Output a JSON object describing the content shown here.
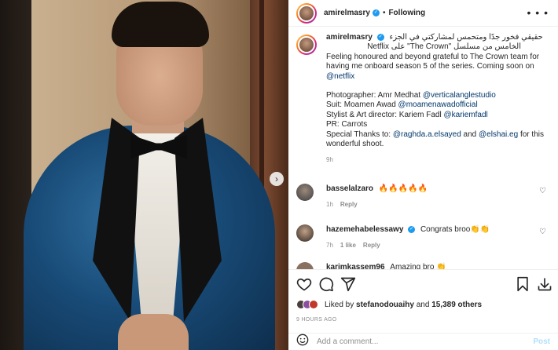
{
  "header": {
    "username": "amirelmasry",
    "verified_symbol": "✓",
    "separator": "•",
    "follow_status": "Following",
    "more_icon": "more-horizontal-icon"
  },
  "caption": {
    "username": "amirelmasry",
    "arabic_line1": "حقيقي فخور جدًا ومتحمس لمشاركتي في الجزء",
    "arabic_line2": "الخامس من مسلسل \"The Crown\" على Netflix",
    "line1": "Feeling honoured and beyond grateful to The Crown team for",
    "line2": "having me onboard season 5 of the series. Coming soon on",
    "netflix_handle": "@netflix",
    "photographer_label": "Photographer: Amr Medhat",
    "photographer_handle": "@verticalanglestudio",
    "suit_label": "Suit: Moamen Awad",
    "suit_handle": "@moamenawadofficial",
    "stylist_label": "Stylist & Art director: Kariem Fadl",
    "stylist_handle": "@kariemfadl",
    "pr_line": "PR: Carrots",
    "thanks_label": "Special Thanks to:",
    "thanks_handle1": "@raghda.a.elsayed",
    "and_word": "and",
    "thanks_handle2": "@elshai.eg",
    "thanks_tail": "for this",
    "thanks_tail2": "wonderful shoot.",
    "time": "9h"
  },
  "comments": [
    {
      "username": "basselalzaro",
      "text": "🔥🔥🔥🔥🔥",
      "time": "1h",
      "likes": "",
      "reply": "Reply"
    },
    {
      "username": "hazemehabelessawy",
      "text": "Congrats broo👏👏",
      "time": "7h",
      "likes": "1 like",
      "reply": "Reply"
    },
    {
      "username": "karimkassem96",
      "text": "Amazing bro 👏",
      "time": "",
      "likes": "",
      "reply": ""
    }
  ],
  "actions": {
    "like_icon": "heart-icon",
    "comment_icon": "comment-icon",
    "share_icon": "send-icon",
    "save_icon": "bookmark-icon",
    "download_icon": "download-icon"
  },
  "likes": {
    "prefix": "Liked by",
    "user": "stefanodouaihy",
    "mid": "and",
    "count": "15,389 others"
  },
  "posted": "9 HOURS AGO",
  "add_comment": {
    "placeholder": "Add a comment...",
    "post_label": "Post",
    "emoji_icon": "emoji-icon"
  },
  "carousel": {
    "next_icon": "chevron-right-icon",
    "next_glyph": "›"
  },
  "colors": {
    "link": "#00376b",
    "verified": "#1d9bf0",
    "post_disabled": "#b2dffc"
  }
}
